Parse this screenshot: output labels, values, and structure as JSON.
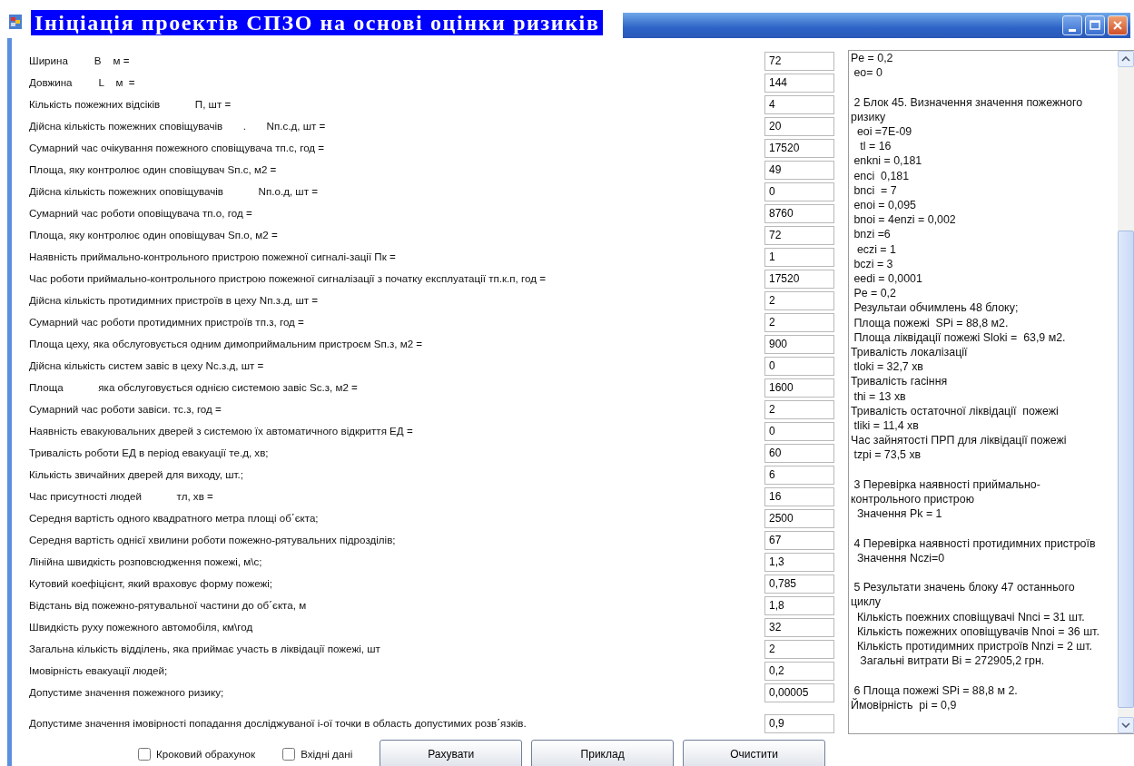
{
  "window": {
    "title": "Ініціація проектів СПЗО на основі оцінки ризиків"
  },
  "fields": [
    {
      "label": "Ширина         В    м =",
      "value": "72"
    },
    {
      "label": "Довжина         L    м  =",
      "value": "144"
    },
    {
      "label": "Кількість пожежних відсіків            П, шт =",
      "value": "4"
    },
    {
      "label": "Дійсна кількість пожежних сповіщувачів       .       Nп.с.д, шт =",
      "value": "20"
    },
    {
      "label": "Сумарний час очікування пожежного сповіщувача тп.с, год =",
      "value": "17520"
    },
    {
      "label": "Площа, яку контролює один сповіщувач Sп.с, м2 =",
      "value": "49"
    },
    {
      "label": "Дійсна кількість пожежних оповіщувачів            Nп.о.д, шт =",
      "value": "0"
    },
    {
      "label": "Сумарний час роботи оповіщувача тп.о, год =",
      "value": "8760"
    },
    {
      "label": "Площа, яку контролює один оповіщувач Sп.о, м2 =",
      "value": "72"
    },
    {
      "label": "Наявність приймально-контрольного пристрою пожежної сигналі-зації Пк =",
      "value": "1"
    },
    {
      "label": "Час роботи приймально-контрольного пристрою пожежної сигналізації з початку експлуатації тп.к.п, год =",
      "value": "17520"
    },
    {
      "label": "Дійсна кількість протидимних пристроїв в цеху Nп.з.д, шт =",
      "value": "2"
    },
    {
      "label": "Сумарний час роботи протидимних пристроїв тп.з, год =",
      "value": "2"
    },
    {
      "label": "Площа цеху, яка обслуговується одним димоприймальним пристроєм Sп.з, м2 =",
      "value": "900"
    },
    {
      "label": "Дійсна кількість систем завіс в цеху Nс.з.д, шт =",
      "value": "0"
    },
    {
      "label": "Площа            яка обслуговується однією системою завіс Sс.з, м2 =",
      "value": "1600"
    },
    {
      "label": "Сумарний час роботи завіси. тс.з, год =",
      "value": "2"
    },
    {
      "label": "Наявність евакуювальних дверей з системою їх автоматичного відкриття ЕД =",
      "value": "0"
    },
    {
      "label": "Тривалість роботи ЕД в період евакуації те.д, хв;",
      "value": "60"
    },
    {
      "label": "Кількість звичайних дверей для виходу, шт.;",
      "value": "6"
    },
    {
      "label": "Час присутності людей            тл, хв =",
      "value": "16"
    },
    {
      "label": "Середня вартість одного квадратного метра площі об΄єкта;",
      "value": "2500"
    },
    {
      "label": "Середня вартість однієї хвилини роботи пожежно-рятувальних підрозділів;",
      "value": "67"
    },
    {
      "label": "Лінійна швидкість розповсюдження пожежі, м\\с;",
      "value": "1,3"
    },
    {
      "label": "Кутовий коефіцієнт, який враховує форму пожежі;",
      "value": "0,785"
    },
    {
      "label": "Відстань від пожежно-рятувальної частини до об΄єкта, м",
      "value": "1,8"
    },
    {
      "label": "Швидкість руху пожежного автомобіля, км\\год",
      "value": "32"
    },
    {
      "label": "Загальна кількість відділень, яка приймає участь в ліквідації пожежі, шт",
      "value": "2"
    },
    {
      "label": "Імовірність евакуації людей;",
      "value": "0,2"
    },
    {
      "label": "Допустиме значення пожежного ризику;",
      "value": "0,00005"
    },
    {
      "label": "Допустиме значення імовірності попадання досліджуваної і-ої точки в область допустимих розв΄язків.",
      "value": "0,9"
    }
  ],
  "output": [
    {
      "lines": [
        "Pe = 0,2",
        " eo= 0"
      ]
    },
    {
      "lines": [
        " 2 Блок 45. Визначення значення пожежного ризику",
        "  eoi =7E-09",
        "   tl = 16",
        " enkni = 0,181",
        " enci  0,181",
        " bnci  = 7",
        " enoi = 0,095",
        " bnoi = 4enzi = 0,002",
        " bnzi =6",
        "  eczi = 1",
        " bczi = 3",
        " eedi = 0,0001",
        " Pe = 0,2",
        " Результаи обчимлень 48 блоку;",
        " Площа пожежі  SPi = 88,8 м2.",
        " Площа ліквідації пожежі Sloki =  63,9 м2.",
        "Тривалість локалізації",
        " tloki = 32,7 хв",
        "Тривалість гасіння",
        " thi = 13 хв",
        "Тривалість остаточної ліквідації  пожежі",
        " tliki = 11,4 хв",
        "Час зайнятості ПРП для ліквідації пожежі",
        " tzpi = 73,5 хв"
      ]
    },
    {
      "lines": [
        " 3 Перевірка наявності приймально-контрольного пристрою",
        "  Значення Pk = 1"
      ]
    },
    {
      "lines": [
        " 4 Перевірка наявності протидимних пристроїв",
        "  Значення Nczi=0"
      ]
    },
    {
      "lines": [
        " 5 Результати значень блоку 47 останнього циклу",
        "  Кількість поежних сповіщувачі Nnci = 31 шт.",
        "  Кількість пожежних оповіщувачів Nnoi = 36 шт.",
        "  Кількість протидимних пристроїв Nnzi = 2 шт.",
        "   Загальні витрати Bi = 272905,2 грн."
      ]
    },
    {
      "lines": [
        " 6 Площа пожежі SPi = 88,8 м 2.",
        "Ймовірність  pi = 0,9"
      ]
    }
  ],
  "checkboxes": [
    {
      "label": "Кроковий обрахунок",
      "checked": false
    },
    {
      "label": "Вхідні дані",
      "checked": false
    }
  ],
  "buttons": [
    "Рахувати",
    "Приклад",
    "Очистити"
  ]
}
